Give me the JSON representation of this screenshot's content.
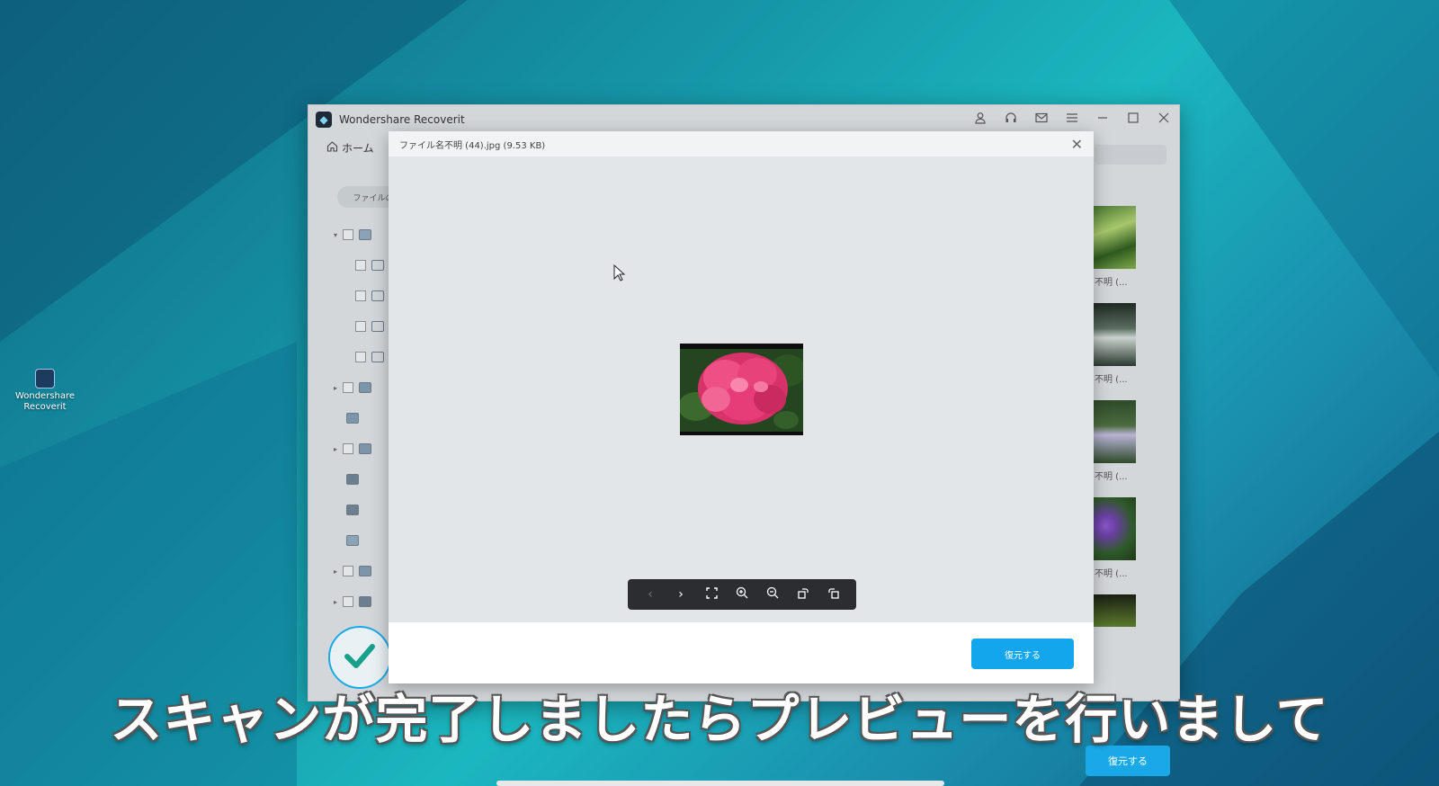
{
  "desktop": {
    "icon_label": "Wondershare Recoverit"
  },
  "app": {
    "title": "Wondershare Recoverit",
    "home_label": "ホーム",
    "sidebar_pill": "ファイルの",
    "thumb_captions": [
      "名不明 (...",
      "名不明 (...",
      "名不明 (...",
      "名不明 (..."
    ],
    "restore_bg_label": "復元する",
    "title_icons": [
      "account-icon",
      "headset-icon",
      "mail-icon",
      "menu-icon",
      "minimize-icon",
      "maximize-icon",
      "close-icon"
    ]
  },
  "preview": {
    "filename": "ファイル名不明 (44).jpg (9.53 KB)",
    "restore_label": "復元する",
    "toolbar_icons": [
      "prev-icon",
      "next-icon",
      "fullscreen-icon",
      "zoom-in-icon",
      "zoom-out-icon",
      "rotate-right-icon",
      "rotate-left-icon"
    ]
  },
  "subtitle": "スキャンが完了しましたらプレビューを行いまして",
  "colors": {
    "accent": "#13a6ec",
    "toolbar_bg": "#2b2d31",
    "flower": "#e63d79"
  }
}
